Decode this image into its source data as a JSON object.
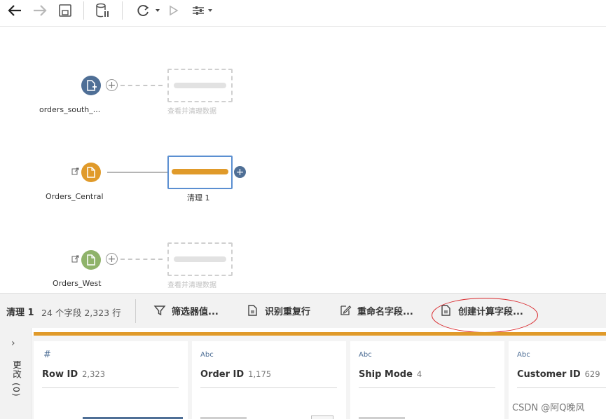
{
  "toolbar": {
    "icons": [
      "back-arrow-icon",
      "forward-arrow-icon",
      "save-icon",
      "database-pause-icon",
      "refresh-icon",
      "run-icon",
      "settings-sliders-icon"
    ]
  },
  "flow": {
    "inputs": [
      {
        "label": "orders_south_...",
        "color": "#4f6f96",
        "icon": "file-plus-icon",
        "ghost_text": "查看并清理数据"
      },
      {
        "label": "Orders_Central",
        "color": "#e09a2a",
        "icon": "file-icon",
        "clean_label": "清理 1"
      },
      {
        "label": "Orders_West",
        "color": "#8fb36a",
        "icon": "file-icon",
        "ghost_text": "查看并清理数据"
      }
    ]
  },
  "step_bar": {
    "title": "清理 1",
    "meta": "24 个字段  2,323 行",
    "actions": [
      {
        "label": "筛选器值...",
        "icon": "filter-icon"
      },
      {
        "label": "识别重复行",
        "icon": "duplicate-rows-icon"
      },
      {
        "label": "重命名字段...",
        "icon": "rename-edit-icon"
      },
      {
        "label": "创建计算字段...",
        "icon": "calculated-field-icon"
      }
    ]
  },
  "changes_panel": {
    "label": "更改 (0)"
  },
  "fields": [
    {
      "type": "#",
      "name": "Row ID",
      "count": "2,323"
    },
    {
      "type": "Abc",
      "name": "Order ID",
      "count": "1,175"
    },
    {
      "type": "Abc",
      "name": "Ship Mode",
      "count": "4"
    },
    {
      "type": "Abc",
      "name": "Customer ID",
      "count": "629"
    }
  ],
  "watermark": "CSDN @阿Q晚风",
  "colors": {
    "accent_orange": "#e09a2a",
    "accent_blue": "#4f6f96",
    "annotation_red": "#d9262a",
    "green": "#8fb36a"
  }
}
